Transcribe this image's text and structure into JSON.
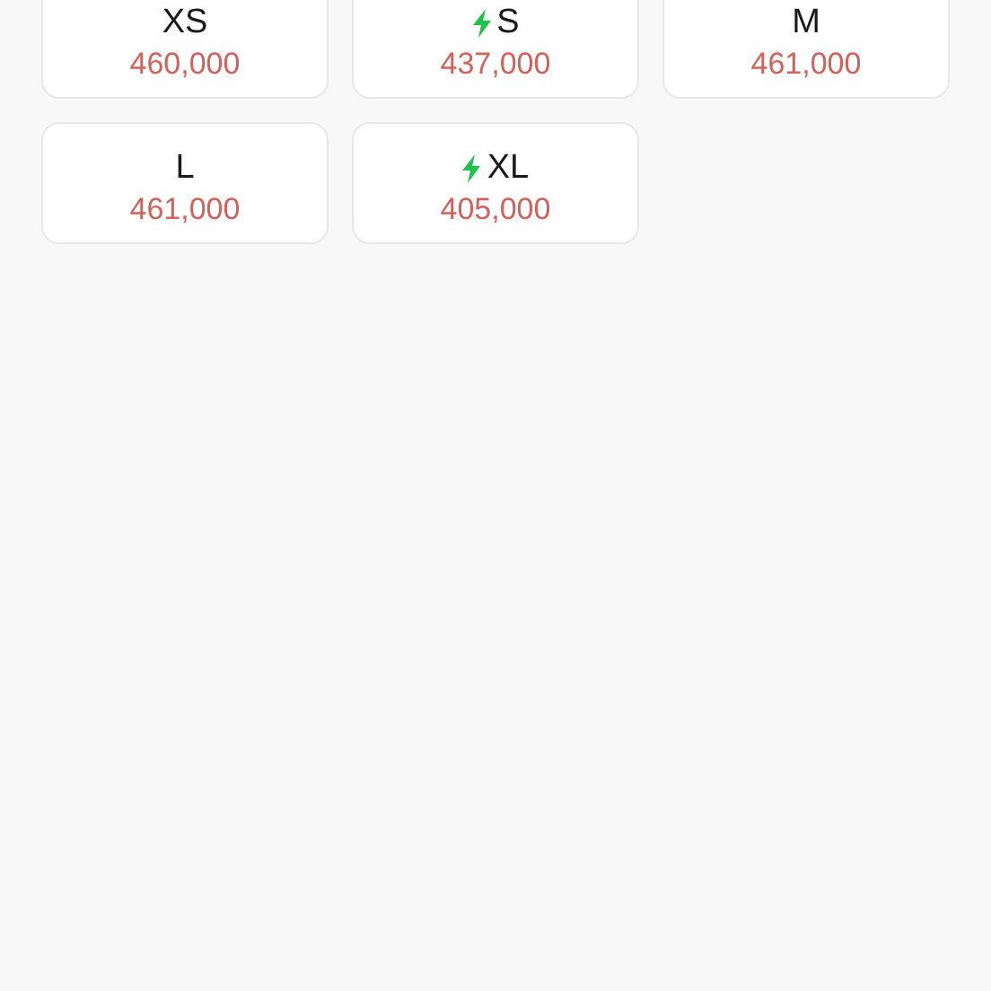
{
  "sizes": [
    {
      "size": "XS",
      "price": "460,000",
      "express": false
    },
    {
      "size": "S",
      "price": "437,000",
      "express": true
    },
    {
      "size": "M",
      "price": "461,000",
      "express": false
    },
    {
      "size": "L",
      "price": "461,000",
      "express": false
    },
    {
      "size": "XL",
      "price": "405,000",
      "express": true
    }
  ]
}
